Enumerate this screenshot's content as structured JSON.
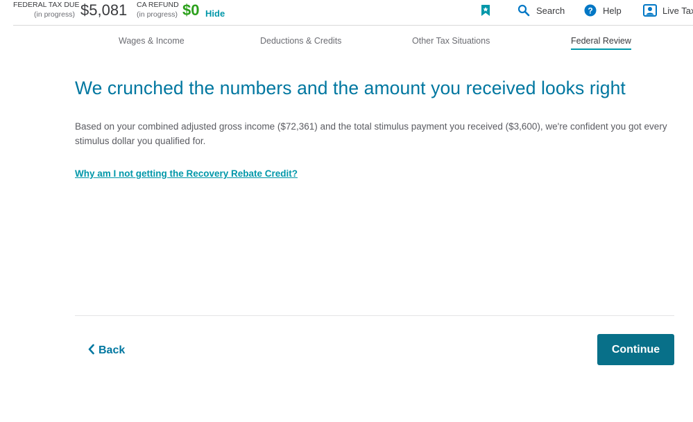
{
  "header": {
    "federal": {
      "label": "FEDERAL TAX DUE",
      "status": "(in progress)",
      "amount": "$5,081"
    },
    "state": {
      "label": "CA REFUND",
      "status": "(in progress)",
      "amount": "$0"
    },
    "hide_label": "Hide",
    "utilities": [
      {
        "icon": "bookmark-icon",
        "label": ""
      },
      {
        "icon": "search-icon",
        "label": "Search"
      },
      {
        "icon": "help-icon",
        "label": "Help"
      },
      {
        "icon": "live-tax-icon",
        "label": "Live Tax"
      }
    ]
  },
  "tabs": [
    {
      "label": "Wages & Income",
      "active": false
    },
    {
      "label": "Deductions & Credits",
      "active": false
    },
    {
      "label": "Other Tax Situations",
      "active": false
    },
    {
      "label": "Federal Review",
      "active": true
    }
  ],
  "main": {
    "title": "We crunched the numbers and the amount you received looks right",
    "body": "Based on your combined adjusted gross income ($72,361) and the total stimulus payment you received ($3,600), we're confident you got every stimulus dollar you qualified for.",
    "link": "Why am I not getting the Recovery Rebate Credit?"
  },
  "footer": {
    "back_label": "Back",
    "continue_label": "Continue"
  },
  "colors": {
    "accent": "#0097a9",
    "title": "#0077a0",
    "refund": "#2ca01c",
    "button": "#087089"
  }
}
